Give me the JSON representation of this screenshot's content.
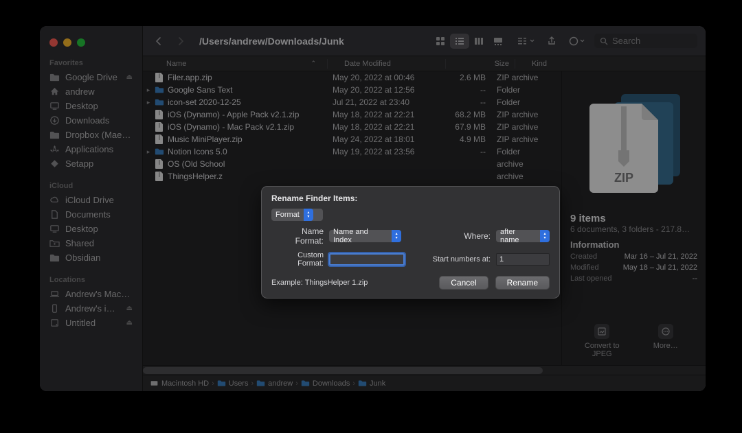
{
  "toolbar": {
    "path_title": "/Users/andrew/Downloads/Junk",
    "search_placeholder": "Search"
  },
  "sidebar": {
    "sections": [
      {
        "label": "Favorites",
        "items": [
          {
            "label": "Google Drive",
            "icon": "folder",
            "eject": true
          },
          {
            "label": "andrew",
            "icon": "home"
          },
          {
            "label": "Desktop",
            "icon": "desktop"
          },
          {
            "label": "Downloads",
            "icon": "download"
          },
          {
            "label": "Dropbox (Maes…",
            "icon": "folder"
          },
          {
            "label": "Applications",
            "icon": "apps"
          },
          {
            "label": "Setapp",
            "icon": "setapp"
          }
        ]
      },
      {
        "label": "iCloud",
        "items": [
          {
            "label": "iCloud Drive",
            "icon": "cloud"
          },
          {
            "label": "Documents",
            "icon": "doc"
          },
          {
            "label": "Desktop",
            "icon": "desktop"
          },
          {
            "label": "Shared",
            "icon": "shared"
          },
          {
            "label": "Obsidian",
            "icon": "folder"
          }
        ]
      },
      {
        "label": "Locations",
        "items": [
          {
            "label": "Andrew's MacB…",
            "icon": "laptop"
          },
          {
            "label": "Andrew's iP…",
            "icon": "phone",
            "eject": true
          },
          {
            "label": "Untitled",
            "icon": "disk",
            "eject": true
          }
        ]
      }
    ]
  },
  "columns": {
    "name": "Name",
    "date": "Date Modified",
    "size": "Size",
    "kind": "Kind"
  },
  "files": [
    {
      "name": "Filer.app.zip",
      "date": "May 20, 2022 at 00:46",
      "size": "2.6 MB",
      "kind": "ZIP archive",
      "type": "zip",
      "expand": false
    },
    {
      "name": "Google Sans Text",
      "date": "May 20, 2022 at 12:56",
      "size": "--",
      "kind": "Folder",
      "type": "folder",
      "expand": true
    },
    {
      "name": "icon-set 2020-12-25",
      "date": "Jul 21, 2022 at 23:40",
      "size": "--",
      "kind": "Folder",
      "type": "folder",
      "expand": true
    },
    {
      "name": "iOS (Dynamo) - Apple Pack v2.1.zip",
      "date": "May 18, 2022 at 22:21",
      "size": "68.2 MB",
      "kind": "ZIP archive",
      "type": "zip",
      "expand": false
    },
    {
      "name": "iOS (Dynamo) - Mac Pack v2.1.zip",
      "date": "May 18, 2022 at 22:21",
      "size": "67.9 MB",
      "kind": "ZIP archive",
      "type": "zip",
      "expand": false
    },
    {
      "name": "Music MiniPlayer.zip",
      "date": "May 24, 2022 at 18:01",
      "size": "4.9 MB",
      "kind": "ZIP archive",
      "type": "zip",
      "expand": false
    },
    {
      "name": "Notion Icons 5.0",
      "date": "May 19, 2022 at 23:56",
      "size": "--",
      "kind": "Folder",
      "type": "folder",
      "expand": true
    },
    {
      "name": "OS (Old School",
      "date": "",
      "size": "",
      "kind": "archive",
      "type": "zip",
      "expand": false
    },
    {
      "name": "ThingsHelper.z",
      "date": "",
      "size": "",
      "kind": "archive",
      "type": "zip",
      "expand": false
    }
  ],
  "preview": {
    "heading": "9 items",
    "sub": "6 documents, 3 folders - 217.8…",
    "info_title": "Information",
    "rows": [
      {
        "k": "Created",
        "v": "Mar 16 – Jul 21, 2022"
      },
      {
        "k": "Modified",
        "v": "May 18 – Jul 21, 2022"
      },
      {
        "k": "Last opened",
        "v": "--"
      }
    ],
    "actions": [
      {
        "label": "Convert to JPEG"
      },
      {
        "label": "More…"
      }
    ]
  },
  "pathbar": [
    {
      "label": "Macintosh HD",
      "icon": "disk"
    },
    {
      "label": "Users",
      "icon": "folder"
    },
    {
      "label": "andrew",
      "icon": "folder"
    },
    {
      "label": "Downloads",
      "icon": "folder"
    },
    {
      "label": "Junk",
      "icon": "folder"
    }
  ],
  "dialog": {
    "title": "Rename Finder Items:",
    "mode": "Format",
    "name_format_label": "Name Format:",
    "name_format_value": "Name and Index",
    "where_label": "Where:",
    "where_value": "after name",
    "custom_format_label": "Custom Format:",
    "custom_format_value": "",
    "start_numbers_label": "Start numbers at:",
    "start_numbers_value": "1",
    "example": "Example: ThingsHelper 1.zip",
    "cancel": "Cancel",
    "rename": "Rename"
  }
}
